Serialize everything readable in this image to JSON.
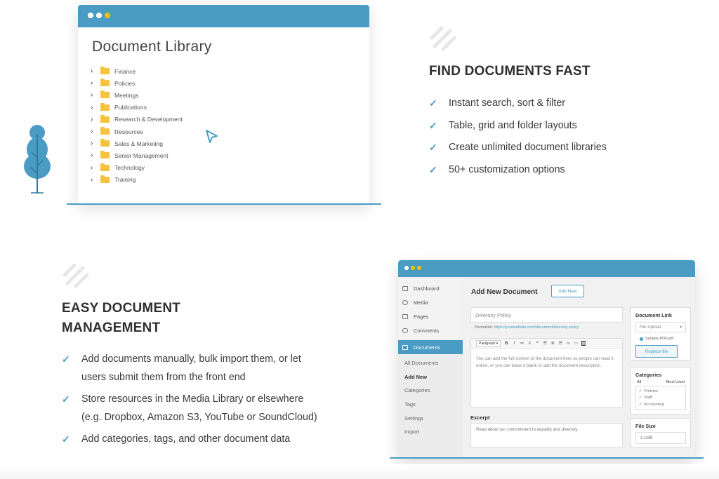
{
  "colors": {
    "accent": "#4a9cc4",
    "folder": "#f7c23e",
    "dot_red": "#ff5f57",
    "dot_yellow": "#f5c400"
  },
  "library": {
    "title": "Document Library",
    "folders": [
      "Finance",
      "Policies",
      "Meetings",
      "Publications",
      "Research & Development",
      "Resources",
      "Sales & Marketing",
      "Senior Management",
      "Technology",
      "Training"
    ]
  },
  "section1": {
    "heading": "FIND DOCUMENTS FAST",
    "features": [
      "Instant search, sort & filter",
      "Table, grid and folder layouts",
      "Create unlimited document libraries",
      "50+ customization options"
    ]
  },
  "section2": {
    "heading_line1": "EASY DOCUMENT",
    "heading_line2": "MANAGEMENT",
    "features": [
      {
        "line1": "Add documents manually, bulk import them, or let",
        "line2": "users submit them from the front end"
      },
      {
        "line1": "Store resources in the Media Library or elsewhere",
        "line2": "(e.g. Dropbox, Amazon S3, YouTube or SoundCloud)"
      },
      {
        "line1": "Add categories, tags, and other document data",
        "line2": ""
      }
    ]
  },
  "admin": {
    "sidebar": [
      "Dashboard",
      "Media",
      "Pages",
      "Comments"
    ],
    "sidebar_active": "Documents",
    "submenu": [
      "All Documents",
      "Add New",
      "Categories",
      "Tags",
      "Settings",
      "Import"
    ],
    "page_title": "Add New Document",
    "add_new_button": "Add New",
    "doc_title_value": "Diversity Policy",
    "permalink_label": "Permalink:",
    "permalink_url": "https://yourwebsite.com/document/diversity-policy",
    "format_select": "Paragraph",
    "editor_text": "You can add the full content of the document here so people can read it online, or you can leave it blank or add the document description.",
    "excerpt_label": "Excerpt",
    "excerpt_text": "Read about our commitment to equality and diversity.",
    "doc_link_heading": "Document Link",
    "doc_link_select": "File Upload",
    "file_name": "Sample-PDF.pdf",
    "replace_button": "Replace file",
    "categories_heading": "Categories",
    "cat_tab_all": "All",
    "cat_tab_most_used": "Most Used",
    "categories": [
      "Policies",
      "Staff",
      "Accounting"
    ],
    "file_size_heading": "File Size",
    "file_size_value": "1.1MB"
  }
}
